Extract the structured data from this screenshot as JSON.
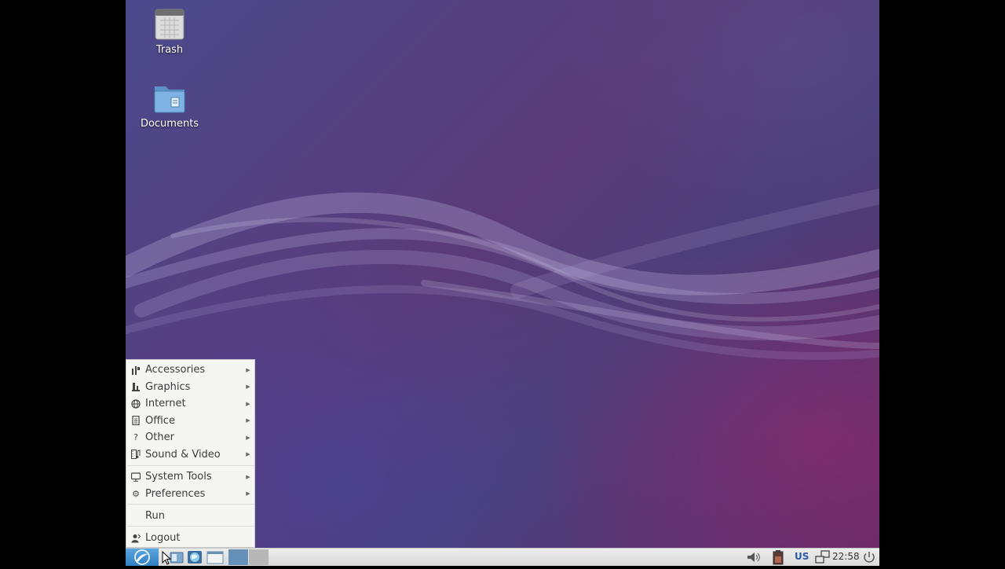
{
  "desktop": {
    "icons": [
      {
        "label": "Trash",
        "icon": "trash-icon"
      },
      {
        "label": "Documents",
        "icon": "folder-documents-icon"
      }
    ]
  },
  "menu": {
    "categories": [
      {
        "label": "Accessories",
        "icon": "accessories-icon"
      },
      {
        "label": "Graphics",
        "icon": "graphics-icon"
      },
      {
        "label": "Internet",
        "icon": "globe-icon"
      },
      {
        "label": "Office",
        "icon": "office-document-icon"
      },
      {
        "label": "Other",
        "icon": "question-icon"
      },
      {
        "label": "Sound & Video",
        "icon": "media-icon"
      }
    ],
    "system": [
      {
        "label": "System Tools",
        "icon": "monitor-icon"
      },
      {
        "label": "Preferences",
        "icon": "gear-icon"
      }
    ],
    "run_label": "Run",
    "logout_label": "Logout"
  },
  "taskbar": {
    "keyboard_layout": "US",
    "clock": "22:58"
  },
  "colors": {
    "accent": "#2f7fc2",
    "taskbar_bg": "#e3e3e3",
    "menu_bg": "#f5f5f4"
  }
}
